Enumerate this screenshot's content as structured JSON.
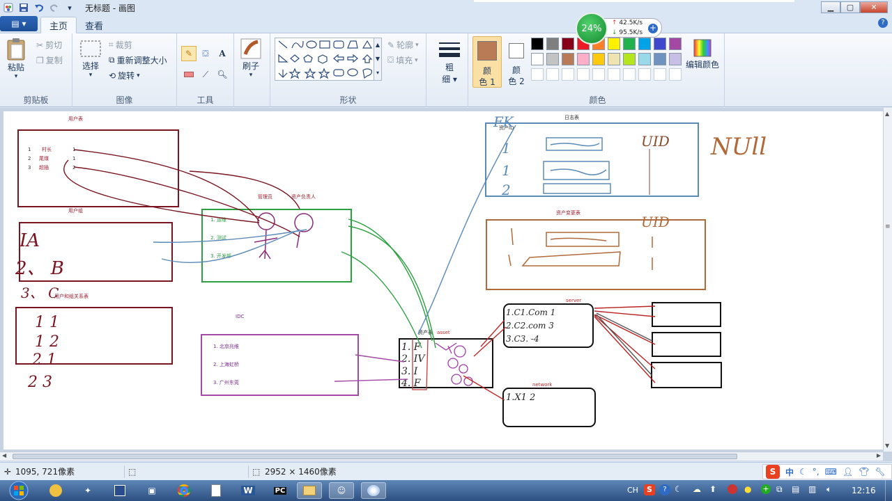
{
  "window": {
    "title": "无标题 - 画图"
  },
  "tabs": {
    "file": "▤ ▾",
    "home": "主页",
    "view": "查看"
  },
  "ribbon": {
    "clipboard": {
      "label": "剪贴板",
      "paste": "粘贴",
      "cut": "剪切",
      "copy": "复制"
    },
    "image": {
      "label": "图像",
      "select": "选择",
      "crop": "裁剪",
      "resize": "重新调整大小",
      "rotate": "旋转"
    },
    "tools": {
      "label": "工具"
    },
    "brushes": {
      "label": "刷子"
    },
    "shapes": {
      "label": "形状",
      "outline": "轮廓",
      "fill": "填充"
    },
    "size": {
      "label1": "粗",
      "label2": "细"
    },
    "color1": {
      "label1": "颜",
      "label2": "色 1",
      "value": "#b97b56"
    },
    "color2": {
      "label1": "颜",
      "label2": "色 2",
      "value": "#ffffff"
    },
    "colors": {
      "label": "颜色",
      "edit": "编辑颜色",
      "row1": [
        "#000000",
        "#7f7f7f",
        "#880015",
        "#ed1c24",
        "#ff7f27",
        "#fff200",
        "#22b14c",
        "#00a2e8",
        "#3f48cc",
        "#a349a4"
      ],
      "row2": [
        "#ffffff",
        "#c3c3c3",
        "#b97a57",
        "#ffaec9",
        "#ffc90e",
        "#efe4b0",
        "#b5e61d",
        "#99d9ea",
        "#7092be",
        "#c8bfe7"
      ]
    }
  },
  "network_widget": {
    "percent": "24%",
    "up": "42.5K/s",
    "down": "95.5K/s"
  },
  "status": {
    "cursor": "1095, 721像素",
    "size": "2952 × 1460像素"
  },
  "taskbar": {
    "clock": "12:16",
    "ime": "CH",
    "ime2": "中"
  },
  "drawing": {
    "user_table": "用户表",
    "user_rows": [
      {
        "id": "1",
        "name": "村长",
        "x": "1"
      },
      {
        "id": "2",
        "name": "尾煤",
        "x": "1"
      },
      {
        "id": "3",
        "name": "超插",
        "x": "2"
      }
    ],
    "group_table": "用户组",
    "relation_table": "用户和组关系表",
    "admin": "管理员",
    "asset_owner": "资产负责人",
    "dept_rows": [
      "1.  运维",
      "2.  测试",
      "3.  开发部"
    ],
    "idc_title": "IDC",
    "idc_rows": [
      "1. 北京兆维",
      "2. 上海虹桥",
      "3. 广州东莞"
    ],
    "asset_title": "资产表",
    "asset_en": "asset",
    "log_table": "日志表",
    "asset_id": "资产ID",
    "asset_change": "资产变更表",
    "server": "server",
    "network": "network",
    "hand_fk": "FK",
    "hand_null": "NUll",
    "hand_uid": "UID",
    "hand_uid2": "UID",
    "hand_ia": "IA",
    "hand_b": "2、 B",
    "hand_c": "3、 C",
    "rel_rows": [
      "1      1",
      "1      2",
      "2      1",
      "2      3"
    ],
    "server_rows": [
      "1.C1.Com  1",
      "2.C2.com 3",
      "3.C3. -4"
    ],
    "network_row": "1.X1   2",
    "log_rows": [
      "1",
      "1",
      "2"
    ]
  }
}
